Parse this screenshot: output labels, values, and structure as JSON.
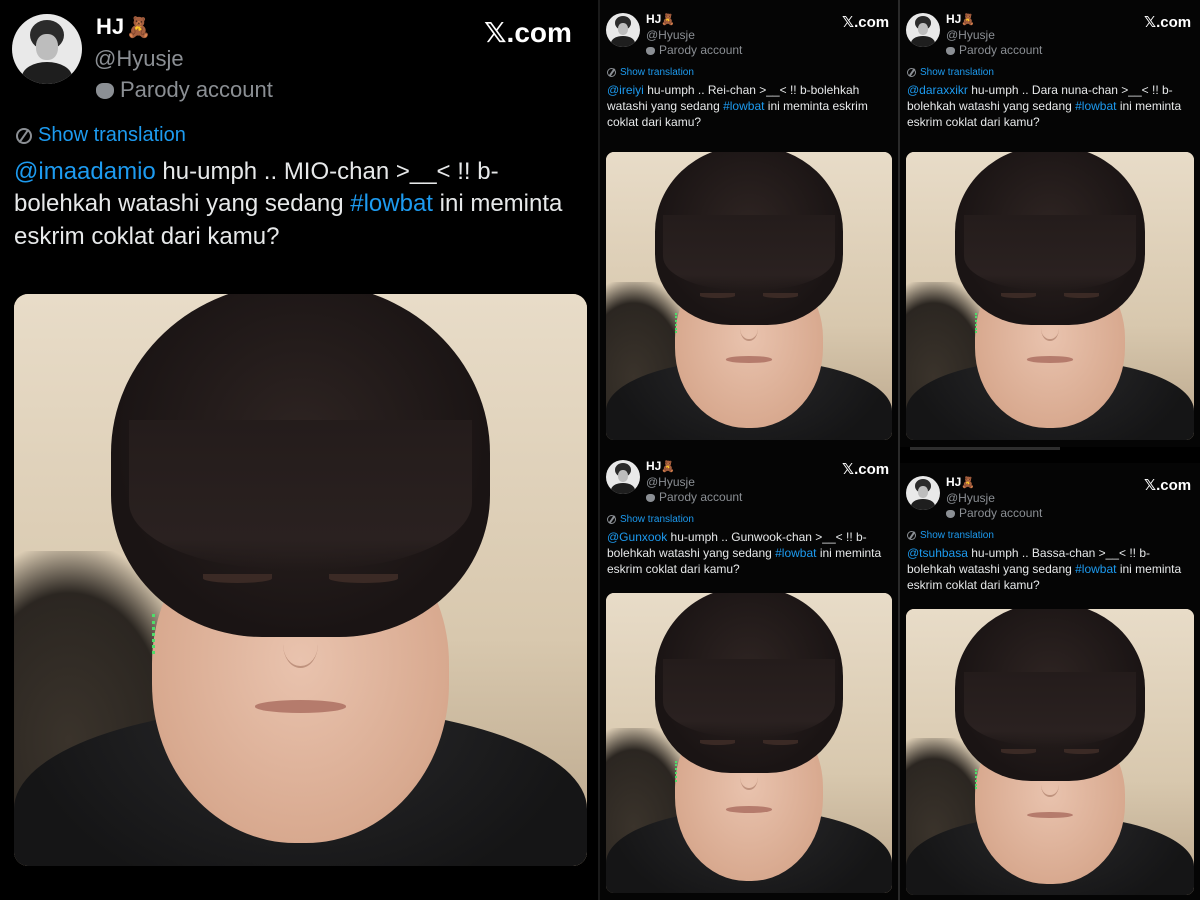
{
  "main": {
    "name": "HJ",
    "name_emoji": "🧸",
    "handle": "@Hyusje",
    "parody": "Parody account",
    "brand": "𝕏.com",
    "show_translation": "Show translation",
    "mention": "@imaadamio",
    "text_before_tag": " hu-umph .. MIO-chan >__< !! b-bolehkah watashi yang sedang ",
    "hashtag": "#lowbat",
    "text_after_tag": " ini meminta eskrim coklat dari kamu?"
  },
  "small_posts": [
    {
      "name": "HJ",
      "name_emoji": "🧸",
      "handle": "@Hyusje",
      "parody": "Parody account",
      "brand": "𝕏.com",
      "show_translation": "Show translation",
      "mention": "@ireiyi",
      "text_before_tag": " hu-umph .. Rei-chan >__< !! b-bolehkah watashi yang sedang ",
      "hashtag": "#lowbat",
      "text_after_tag": " ini meminta eskrim coklat dari kamu?"
    },
    {
      "name": "HJ",
      "name_emoji": "🧸",
      "handle": "@Hyusje",
      "parody": "Parody account",
      "brand": "𝕏.com",
      "show_translation": "Show translation",
      "mention": "@daraxxikr",
      "text_before_tag": " hu-umph .. Dara nuna-chan >__< !! b-bolehkah watashi yang sedang ",
      "hashtag": "#lowbat",
      "text_after_tag": " ini meminta eskrim coklat dari kamu?"
    },
    {
      "name": "HJ",
      "name_emoji": "🧸",
      "handle": "@Hyusje",
      "parody": "Parody account",
      "brand": "𝕏.com",
      "show_translation": "Show translation",
      "mention": "@Gunxook",
      "text_before_tag": " hu-umph .. Gunwook-chan >__< !! b-bolehkah watashi yang sedang ",
      "hashtag": "#lowbat",
      "text_after_tag": " ini meminta eskrim coklat dari kamu?"
    },
    {
      "name": "HJ",
      "name_emoji": "🧸",
      "handle": "@Hyusje",
      "parody": "Parody account",
      "brand": "𝕏.com",
      "show_translation": "Show translation",
      "mention": "@tsuhbasa",
      "text_before_tag": " hu-umph .. Bassa-chan >__< !! b-bolehkah watashi yang sedang ",
      "hashtag": "#lowbat",
      "text_after_tag": " ini meminta eskrim coklat dari kamu?"
    }
  ],
  "colors": {
    "link": "#1d9bf0",
    "muted": "#8b8f94",
    "background": "#000000"
  }
}
